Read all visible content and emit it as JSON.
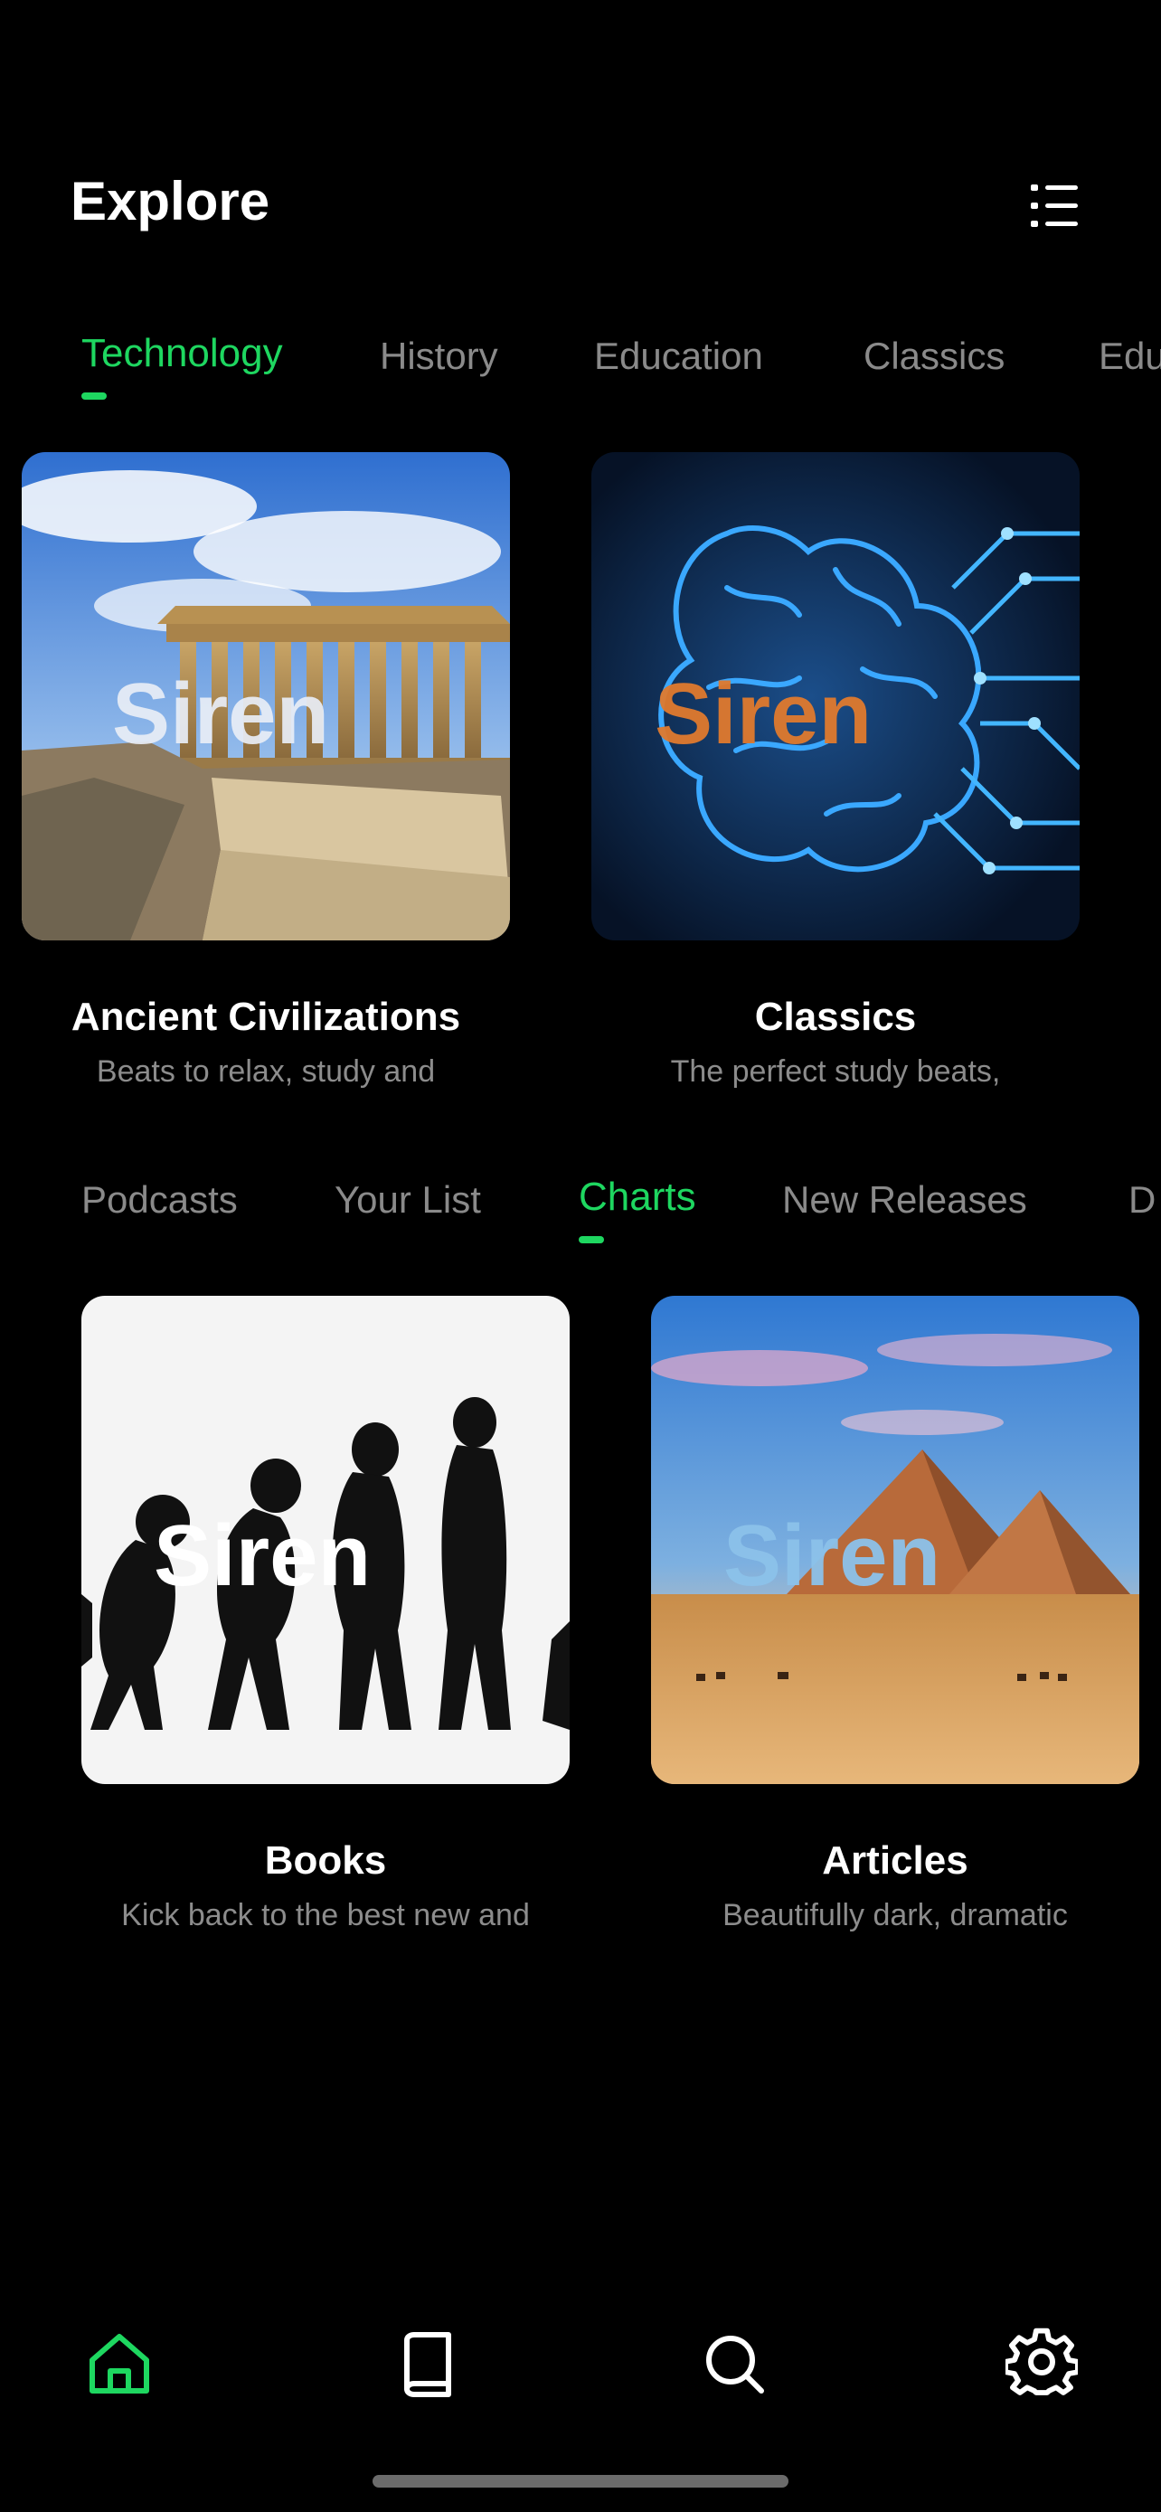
{
  "header": {
    "title": "Explore",
    "menu_icon": "list-icon"
  },
  "categories_row1": {
    "tabs": [
      {
        "label": "Technology",
        "active": true
      },
      {
        "label": "History",
        "active": false
      },
      {
        "label": "Education",
        "active": false
      },
      {
        "label": "Classics",
        "active": false
      },
      {
        "label": "Edu",
        "active": false
      }
    ]
  },
  "cards_row1": [
    {
      "title": "Ancient Civilizations",
      "subtitle": "Beats to relax, study and",
      "image_text": "Siren",
      "image": "parthenon-ruins"
    },
    {
      "title": "Classics",
      "subtitle": "The perfect study beats,",
      "image_text": "Siren",
      "image": "circuit-brain"
    }
  ],
  "categories_row2": {
    "tabs": [
      {
        "label": "Podcasts",
        "active": false
      },
      {
        "label": "Your List",
        "active": false
      },
      {
        "label": "Charts",
        "active": true
      },
      {
        "label": "New Releases",
        "active": false
      },
      {
        "label": "D",
        "active": false
      }
    ]
  },
  "cards_row2": [
    {
      "title": "Books",
      "subtitle": "Kick back to the best new and",
      "image_text": "Siren",
      "image": "evolution-silhouettes"
    },
    {
      "title": "Articles",
      "subtitle": "Beautifully dark, dramatic",
      "image_text": "Siren",
      "image": "desert-pyramids"
    }
  ],
  "bottom_nav": [
    {
      "icon": "home-icon",
      "active": true
    },
    {
      "icon": "book-icon",
      "active": false
    },
    {
      "icon": "search-icon",
      "active": false
    },
    {
      "icon": "gear-icon",
      "active": false
    }
  ],
  "colors": {
    "accent": "#1ed760",
    "background": "#000000",
    "muted_text": "#8a8a8a"
  }
}
